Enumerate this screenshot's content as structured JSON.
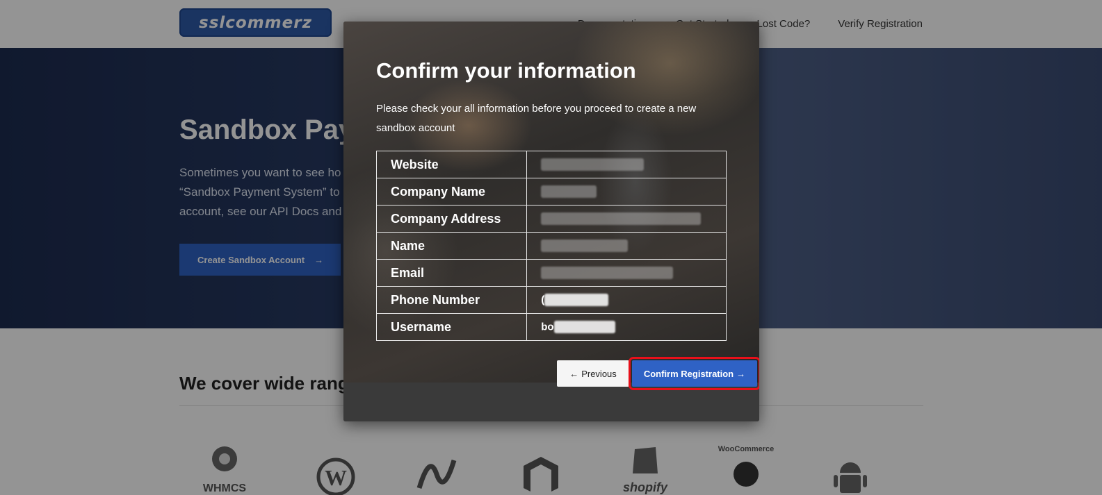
{
  "nav": {
    "logo_text": "sslcommerz",
    "links": [
      "Documentation",
      "Get Started",
      "Lost Code?",
      "Verify Registration"
    ]
  },
  "hero": {
    "title": "Sandbox Pay",
    "text_lines": [
      "Sometimes you want to see ho",
      "“Sandbox Payment System” to",
      "account, see our API Docs and"
    ],
    "button_label": "Create Sandbox Account"
  },
  "coverage": {
    "title": "We cover wide rang",
    "brands": [
      "WHMCS",
      "WordPress",
      "Microsoft .NET",
      "Magento",
      "shopify",
      "WooCommerce",
      "Android"
    ]
  },
  "modal": {
    "title": "Confirm your information",
    "subtitle": "Please check your all information before you proceed to create a new sandbox account",
    "rows": [
      {
        "label": "Website",
        "value_visible": ""
      },
      {
        "label": "Company Name",
        "value_visible": ""
      },
      {
        "label": "Company Address",
        "value_visible": ""
      },
      {
        "label": "Name",
        "value_visible": ""
      },
      {
        "label": "Email",
        "value_visible": ""
      },
      {
        "label": "Phone Number",
        "value_visible": "("
      },
      {
        "label": "Username",
        "value_visible": "bo"
      }
    ],
    "previous_label": "Previous",
    "confirm_label": "Confirm Registration"
  },
  "colors": {
    "brand_blue": "#2f62c5",
    "highlight_red": "#e8101a"
  }
}
